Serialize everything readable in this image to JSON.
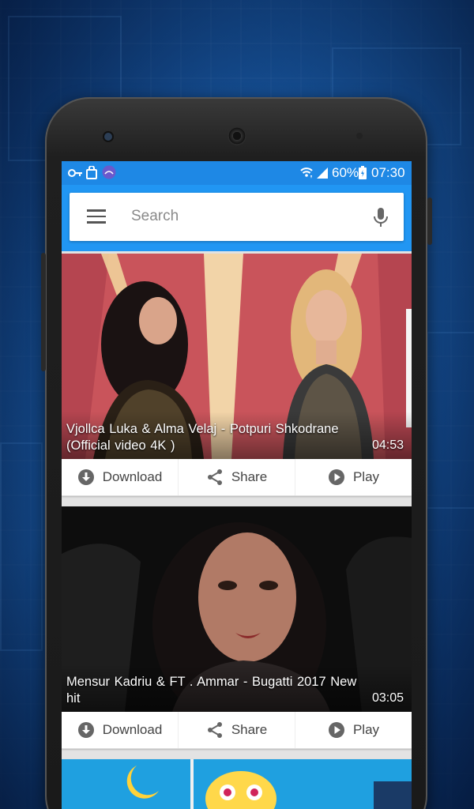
{
  "status_bar": {
    "battery": "60%",
    "time": "07:30",
    "icons": [
      "key-icon",
      "shopping-bag-icon",
      "app-notification-icon",
      "wifi-icon",
      "signal-icon",
      "battery-icon"
    ]
  },
  "search": {
    "placeholder": "Search"
  },
  "videos": [
    {
      "title": "Vjollca  Luka  &  Alma  Velaj - Potpuri  Shkodrane (Official video 4K )",
      "duration": "04:53",
      "actions": {
        "download": "Download",
        "share": "Share",
        "play": "Play"
      }
    },
    {
      "title": "Mensur Kadriu & FT . Ammar - Bugatti 2017 New hit",
      "duration": "03:05",
      "actions": {
        "download": "Download",
        "share": "Share",
        "play": "Play"
      }
    }
  ],
  "colors": {
    "status_bar": "#1e88e5",
    "app_bar": "#2196f3",
    "background": "#0d3f78"
  }
}
